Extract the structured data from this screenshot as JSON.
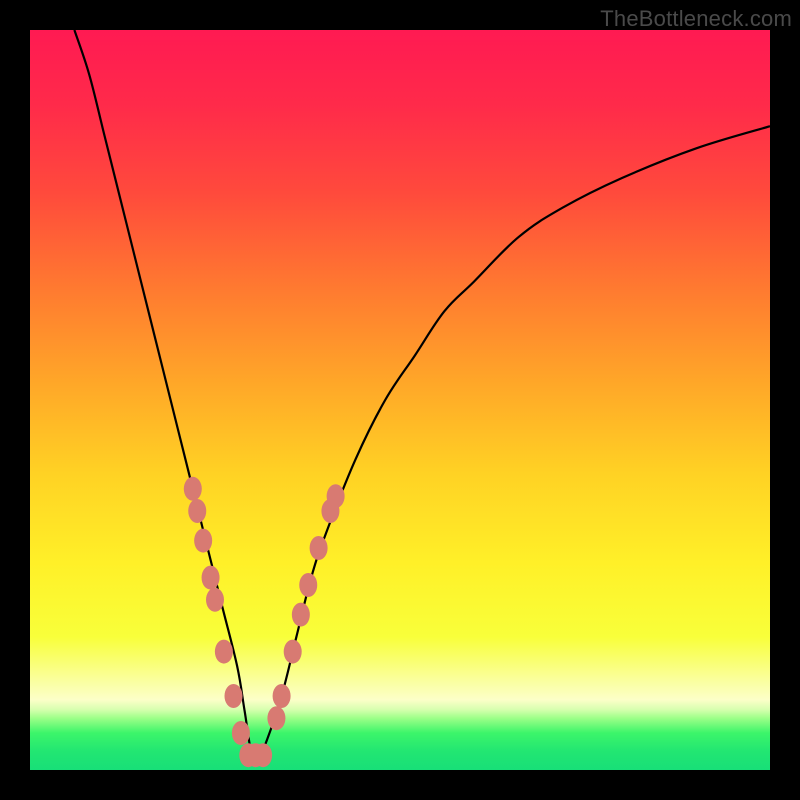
{
  "watermark": "TheBottleneck.com",
  "gradient_stops": [
    {
      "offset": 0.0,
      "color": "#ff1a52"
    },
    {
      "offset": 0.1,
      "color": "#ff2a4a"
    },
    {
      "offset": 0.22,
      "color": "#ff4a3c"
    },
    {
      "offset": 0.35,
      "color": "#ff7a30"
    },
    {
      "offset": 0.48,
      "color": "#ffa828"
    },
    {
      "offset": 0.6,
      "color": "#ffd224"
    },
    {
      "offset": 0.72,
      "color": "#fff028"
    },
    {
      "offset": 0.82,
      "color": "#f8ff3a"
    },
    {
      "offset": 0.88,
      "color": "#faffa0"
    },
    {
      "offset": 0.905,
      "color": "#fcffc8"
    },
    {
      "offset": 0.918,
      "color": "#d8ffb0"
    },
    {
      "offset": 0.93,
      "color": "#9cff88"
    },
    {
      "offset": 0.95,
      "color": "#3cf56a"
    },
    {
      "offset": 0.975,
      "color": "#22e672"
    },
    {
      "offset": 1.0,
      "color": "#18df78"
    }
  ],
  "chart_data": {
    "type": "line",
    "title": "",
    "xlabel": "",
    "ylabel": "",
    "xlim": [
      0,
      100
    ],
    "ylim": [
      0,
      100
    ],
    "x_min_curve": 30,
    "series": [
      {
        "name": "bottleneck-curve",
        "x": [
          6,
          8,
          10,
          12,
          14,
          16,
          18,
          20,
          22,
          24,
          26,
          28,
          29,
          30,
          31,
          32,
          34,
          36,
          38,
          40,
          44,
          48,
          52,
          56,
          60,
          66,
          72,
          80,
          90,
          100
        ],
        "y": [
          100,
          94,
          86,
          78,
          70,
          62,
          54,
          46,
          38,
          30,
          22,
          14,
          8,
          2,
          2,
          4,
          10,
          18,
          26,
          32,
          42,
          50,
          56,
          62,
          66,
          72,
          76,
          80,
          84,
          87
        ]
      }
    ],
    "markers": {
      "name": "highlight-dots",
      "color": "#d87a72",
      "points": [
        {
          "x": 22.0,
          "y": 38
        },
        {
          "x": 22.6,
          "y": 35
        },
        {
          "x": 23.4,
          "y": 31
        },
        {
          "x": 24.4,
          "y": 26
        },
        {
          "x": 25.0,
          "y": 23
        },
        {
          "x": 26.2,
          "y": 16
        },
        {
          "x": 27.5,
          "y": 10
        },
        {
          "x": 28.5,
          "y": 5
        },
        {
          "x": 29.5,
          "y": 2
        },
        {
          "x": 30.5,
          "y": 2
        },
        {
          "x": 31.5,
          "y": 2
        },
        {
          "x": 33.3,
          "y": 7
        },
        {
          "x": 34.0,
          "y": 10
        },
        {
          "x": 35.5,
          "y": 16
        },
        {
          "x": 36.6,
          "y": 21
        },
        {
          "x": 37.6,
          "y": 25
        },
        {
          "x": 39.0,
          "y": 30
        },
        {
          "x": 40.6,
          "y": 35
        },
        {
          "x": 41.3,
          "y": 37
        }
      ]
    }
  }
}
